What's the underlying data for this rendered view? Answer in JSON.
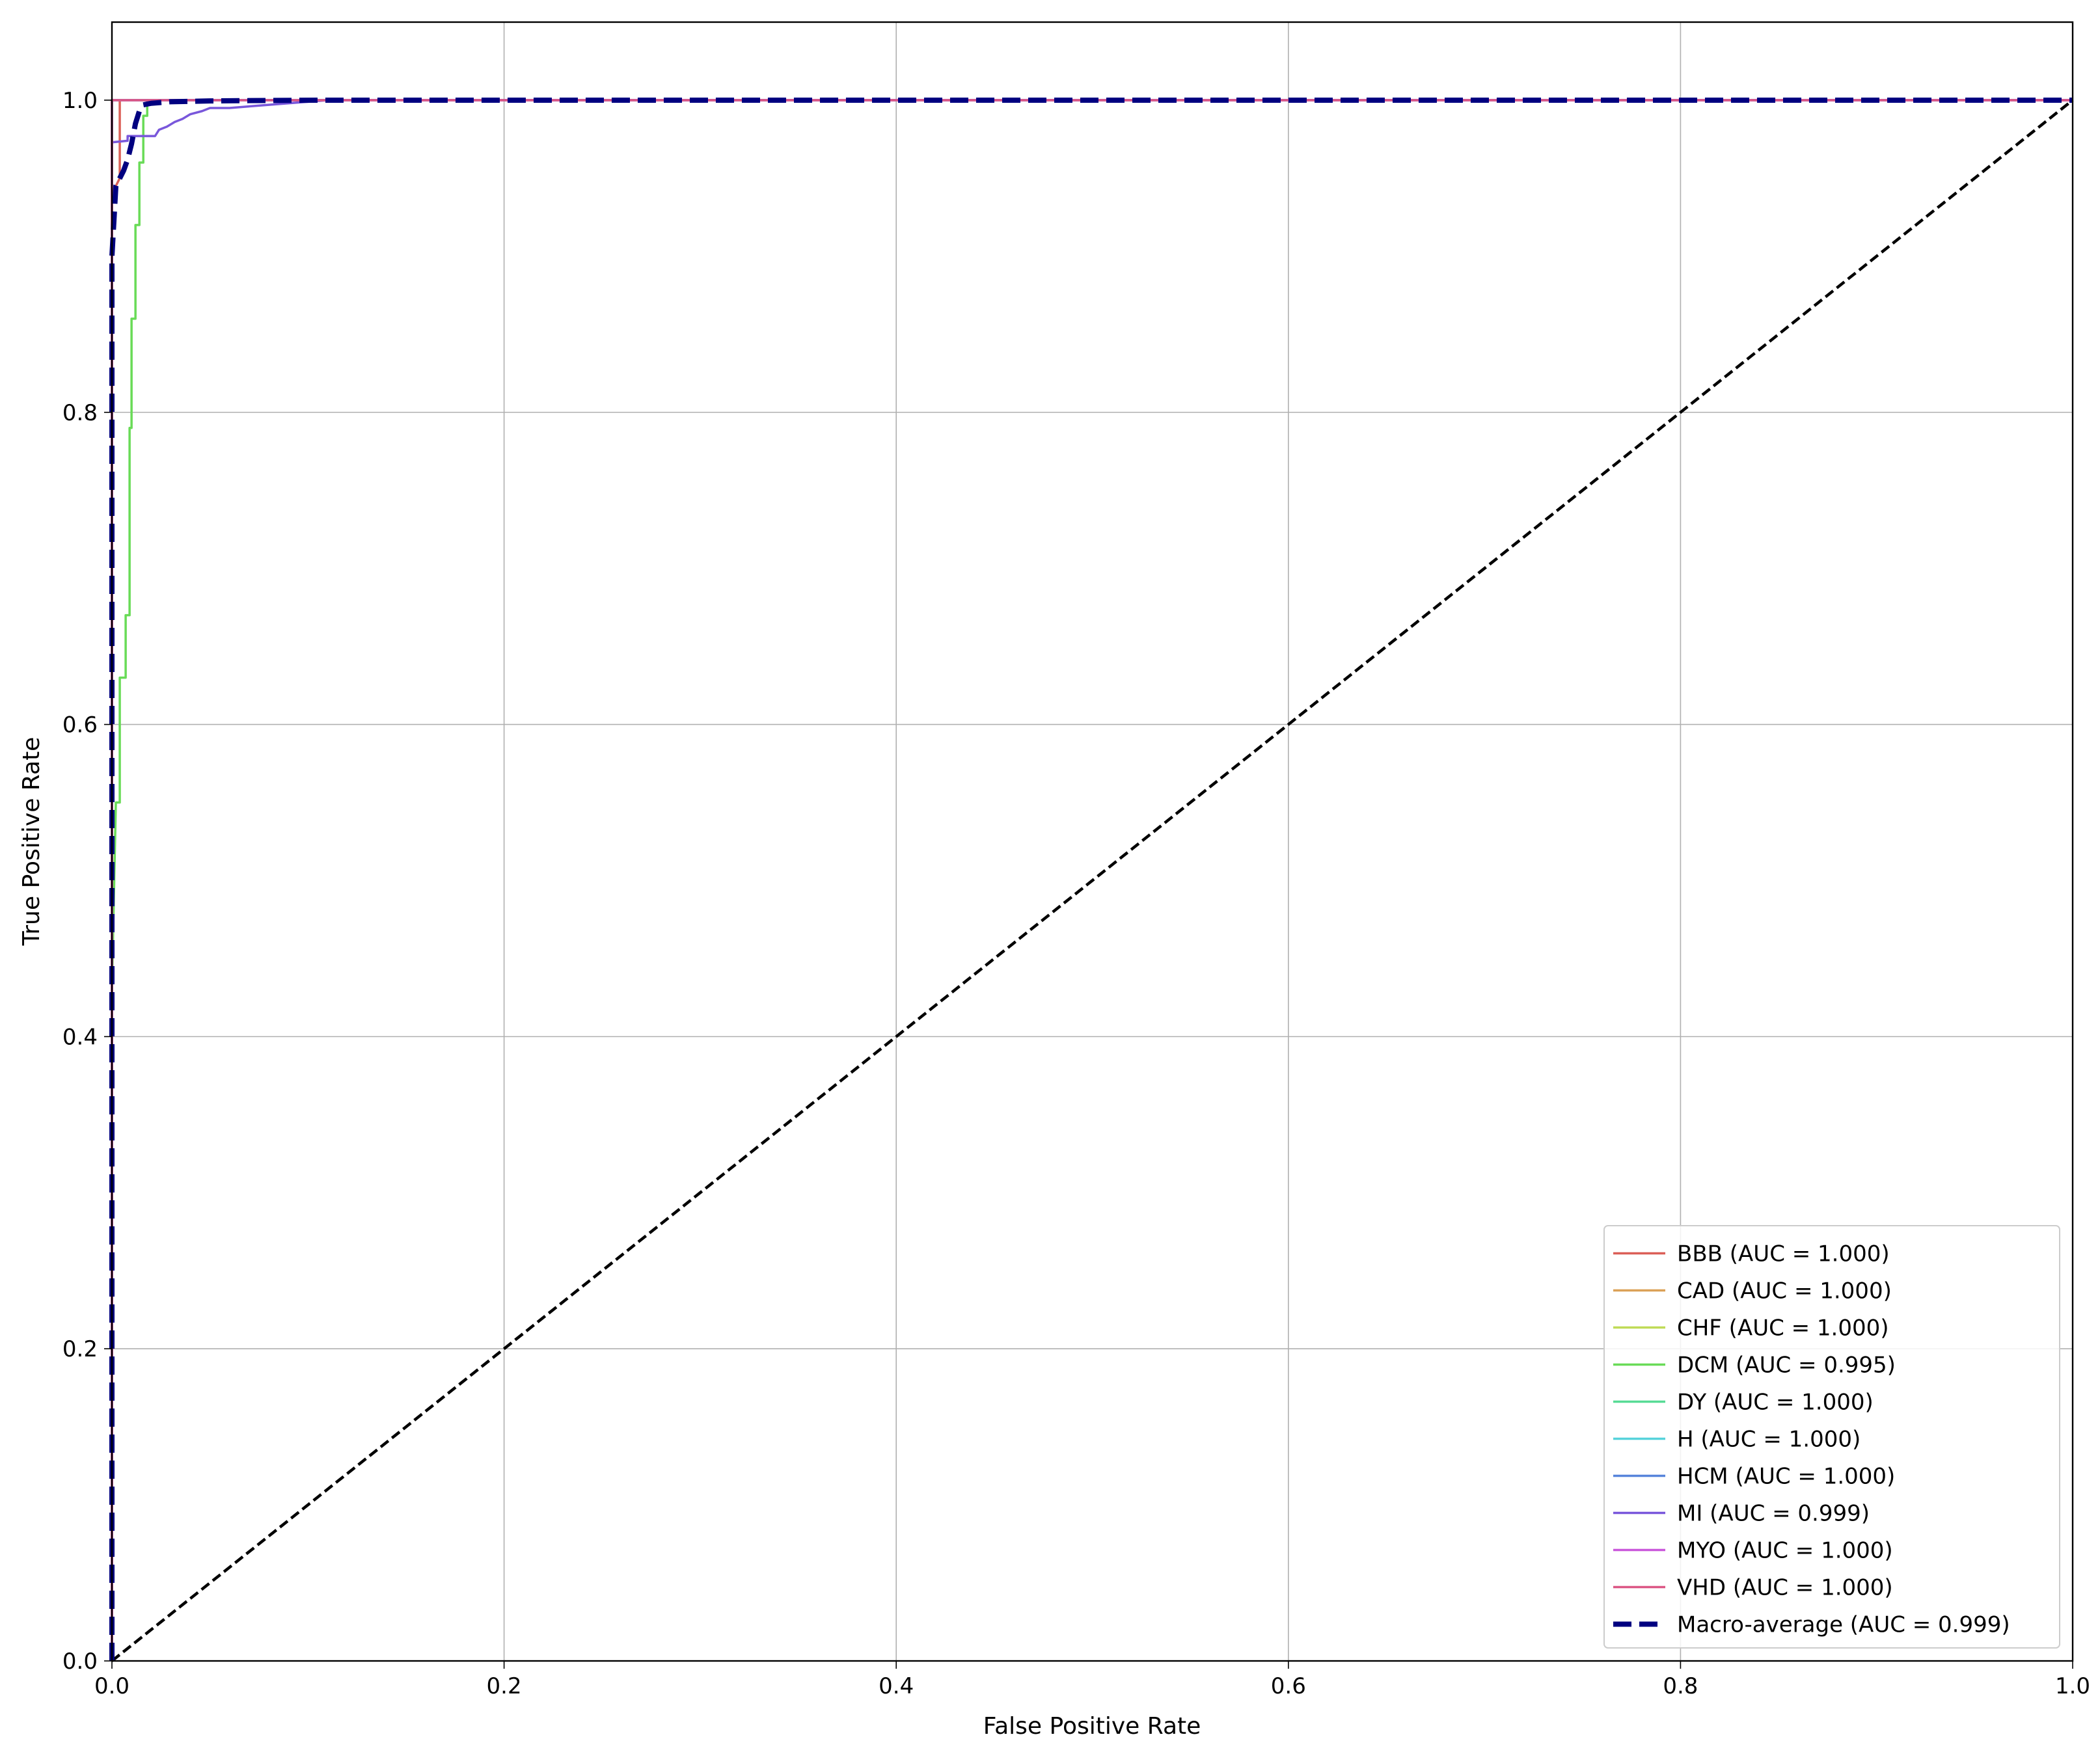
{
  "chart_data": {
    "type": "line",
    "title": "",
    "xlabel": "False Positive Rate",
    "ylabel": "True Positive Rate",
    "xlim": [
      0.0,
      1.0
    ],
    "ylim": [
      0.0,
      1.05
    ],
    "grid": true,
    "legend_position": "lower-right",
    "x_ticks": [
      "0.0",
      "0.2",
      "0.4",
      "0.6",
      "0.8",
      "1.0"
    ],
    "y_ticks": [
      "0.0",
      "0.2",
      "0.4",
      "0.6",
      "0.8",
      "1.0"
    ],
    "series": [
      {
        "name": "BBB (AUC = 1.000)",
        "color": "#db5f57",
        "style": "solid",
        "x": [
          0,
          0,
          0.004,
          0.004,
          1
        ],
        "y": [
          0,
          0.94,
          0.95,
          1.0,
          1.0
        ]
      },
      {
        "name": "CAD (AUC = 1.000)",
        "color": "#dba157",
        "style": "solid",
        "x": [
          0,
          0,
          1
        ],
        "y": [
          0,
          1.0,
          1.0
        ]
      },
      {
        "name": "CHF (AUC = 1.000)",
        "color": "#c0db57",
        "style": "solid",
        "x": [
          0,
          0,
          1
        ],
        "y": [
          0,
          1.0,
          1.0
        ]
      },
      {
        "name": "DCM (AUC = 0.995)",
        "color": "#69db57",
        "style": "solid",
        "x": [
          0,
          0,
          0.002,
          0.002,
          0.004,
          0.004,
          0.007,
          0.007,
          0.009,
          0.009,
          0.01,
          0.01,
          0.012,
          0.012,
          0.014,
          0.014,
          0.016,
          0.016,
          0.018,
          0.018,
          1
        ],
        "y": [
          0,
          0.43,
          0.55,
          0.55,
          0.55,
          0.63,
          0.63,
          0.67,
          0.67,
          0.79,
          0.79,
          0.86,
          0.86,
          0.92,
          0.92,
          0.96,
          0.96,
          0.99,
          0.99,
          1.0,
          1.0
        ]
      },
      {
        "name": "DY (AUC = 1.000)",
        "color": "#57db95",
        "style": "solid",
        "x": [
          0,
          0,
          1
        ],
        "y": [
          0,
          1.0,
          1.0
        ]
      },
      {
        "name": "H (AUC = 1.000)",
        "color": "#57d3db",
        "style": "solid",
        "x": [
          0,
          0,
          1
        ],
        "y": [
          0,
          1.0,
          1.0
        ]
      },
      {
        "name": "HCM (AUC = 1.000)",
        "color": "#5784db",
        "style": "solid",
        "x": [
          0,
          0,
          1
        ],
        "y": [
          0,
          1.0,
          1.0
        ]
      },
      {
        "name": "MI (AUC = 0.999)",
        "color": "#7957db",
        "style": "solid",
        "x": [
          0,
          0,
          0.008,
          0.008,
          0.022,
          0.024,
          0.028,
          0.032,
          0.036,
          0.04,
          0.046,
          0.05,
          0.06,
          0.07,
          0.08,
          0.09,
          0.1,
          0.11,
          1
        ],
        "y": [
          0,
          0.973,
          0.974,
          0.977,
          0.977,
          0.981,
          0.983,
          0.986,
          0.988,
          0.991,
          0.993,
          0.995,
          0.995,
          0.996,
          0.997,
          0.998,
          0.999,
          1.0,
          1.0
        ]
      },
      {
        "name": "MYO (AUC = 1.000)",
        "color": "#c957db",
        "style": "solid",
        "x": [
          0,
          0,
          1
        ],
        "y": [
          0,
          1.0,
          1.0
        ]
      },
      {
        "name": "VHD (AUC = 1.000)",
        "color": "#db5785",
        "style": "solid",
        "x": [
          0,
          0,
          1
        ],
        "y": [
          0,
          1.0,
          1.0
        ]
      },
      {
        "name": "Macro-average (AUC = 0.999)",
        "color": "#000080",
        "style": "dashed-thick",
        "x": [
          0,
          0,
          0.002,
          0.004,
          0.006,
          0.008,
          0.01,
          0.012,
          0.014,
          0.016,
          0.02,
          0.03,
          0.05,
          0.08,
          0.11,
          1
        ],
        "y": [
          0,
          0.9,
          0.945,
          0.95,
          0.955,
          0.962,
          0.972,
          0.985,
          0.993,
          0.997,
          0.998,
          0.999,
          0.9995,
          0.9998,
          1.0,
          1.0
        ]
      },
      {
        "name": "",
        "color": "#000000",
        "style": "dashed",
        "x": [
          0,
          1
        ],
        "y": [
          0,
          1
        ]
      }
    ]
  }
}
